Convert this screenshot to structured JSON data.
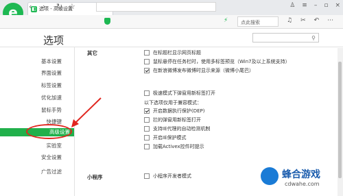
{
  "browser": {
    "tab_title": "选项 - 高级设置",
    "tab_close": "×",
    "new_tab": "+",
    "search_label": "点此搜索"
  },
  "page": {
    "title": "选项",
    "search_placeholder": ""
  },
  "sidebar": {
    "items": [
      {
        "label": "基本设置"
      },
      {
        "label": "界面设置"
      },
      {
        "label": "标签设置"
      },
      {
        "label": "优化加速"
      },
      {
        "label": "鼠标手势"
      },
      {
        "label": "快捷键"
      },
      {
        "label": "高级设置",
        "active": true
      },
      {
        "label": "实验室"
      },
      {
        "label": "安全设置"
      },
      {
        "label": "广告过滤"
      }
    ]
  },
  "sections": {
    "other_label": "其它",
    "other_options": [
      {
        "label": "在标题栏显示网页标题",
        "checked": false
      },
      {
        "label": "鼠标悬停在任务栏时，使用多标签预览（Win7及以上系统支持）",
        "checked": false
      },
      {
        "label": "在新浪微博发布微博时显示来源（微博小尾巴）",
        "checked": true
      }
    ],
    "speed_option": {
      "label": "极速模式下弹窗用新标签打开",
      "checked": false
    },
    "compat_note": "以下选项仅用于兼容模式：",
    "compat_options": [
      {
        "label": "开启数据执行保护(DEP)",
        "checked": true
      },
      {
        "label": "拦的弹窗用新标签打开",
        "checked": false
      },
      {
        "label": "支持IE代理的自动检测机制",
        "checked": false
      },
      {
        "label": "开启IE保护模式",
        "checked": false
      },
      {
        "label": "加载Activex控件时提示",
        "checked": false
      }
    ],
    "miniapp_label": "小程序",
    "miniapp_option": {
      "label": "小程序开发者模式",
      "checked": false
    }
  },
  "watermark": {
    "title": "蜂合游戏",
    "url": "cdwahe.com"
  },
  "colors": {
    "accent": "#21b04b",
    "annotation": "#e0261f"
  }
}
